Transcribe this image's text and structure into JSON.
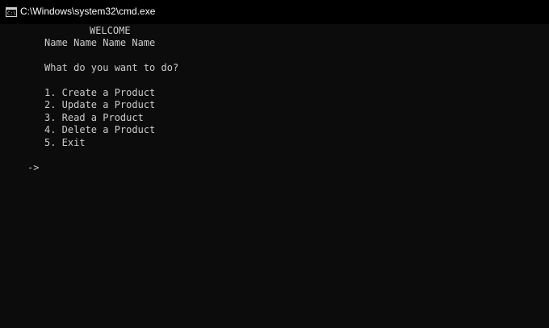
{
  "window": {
    "title": "C:\\Windows\\system32\\cmd.exe",
    "icon": "cmd-window-icon"
  },
  "console": {
    "welcome": "WELCOME",
    "names": "Name Name Name Name",
    "question": "What do you want to do?",
    "menu": [
      "1. Create a Product",
      "2. Update a Product",
      "3. Read a Product",
      "4. Delete a Product",
      "5. Exit"
    ],
    "prompt": "->"
  },
  "colors": {
    "background": "#0c0c0c",
    "titlebar": "#000000",
    "text": "#cccccc"
  }
}
